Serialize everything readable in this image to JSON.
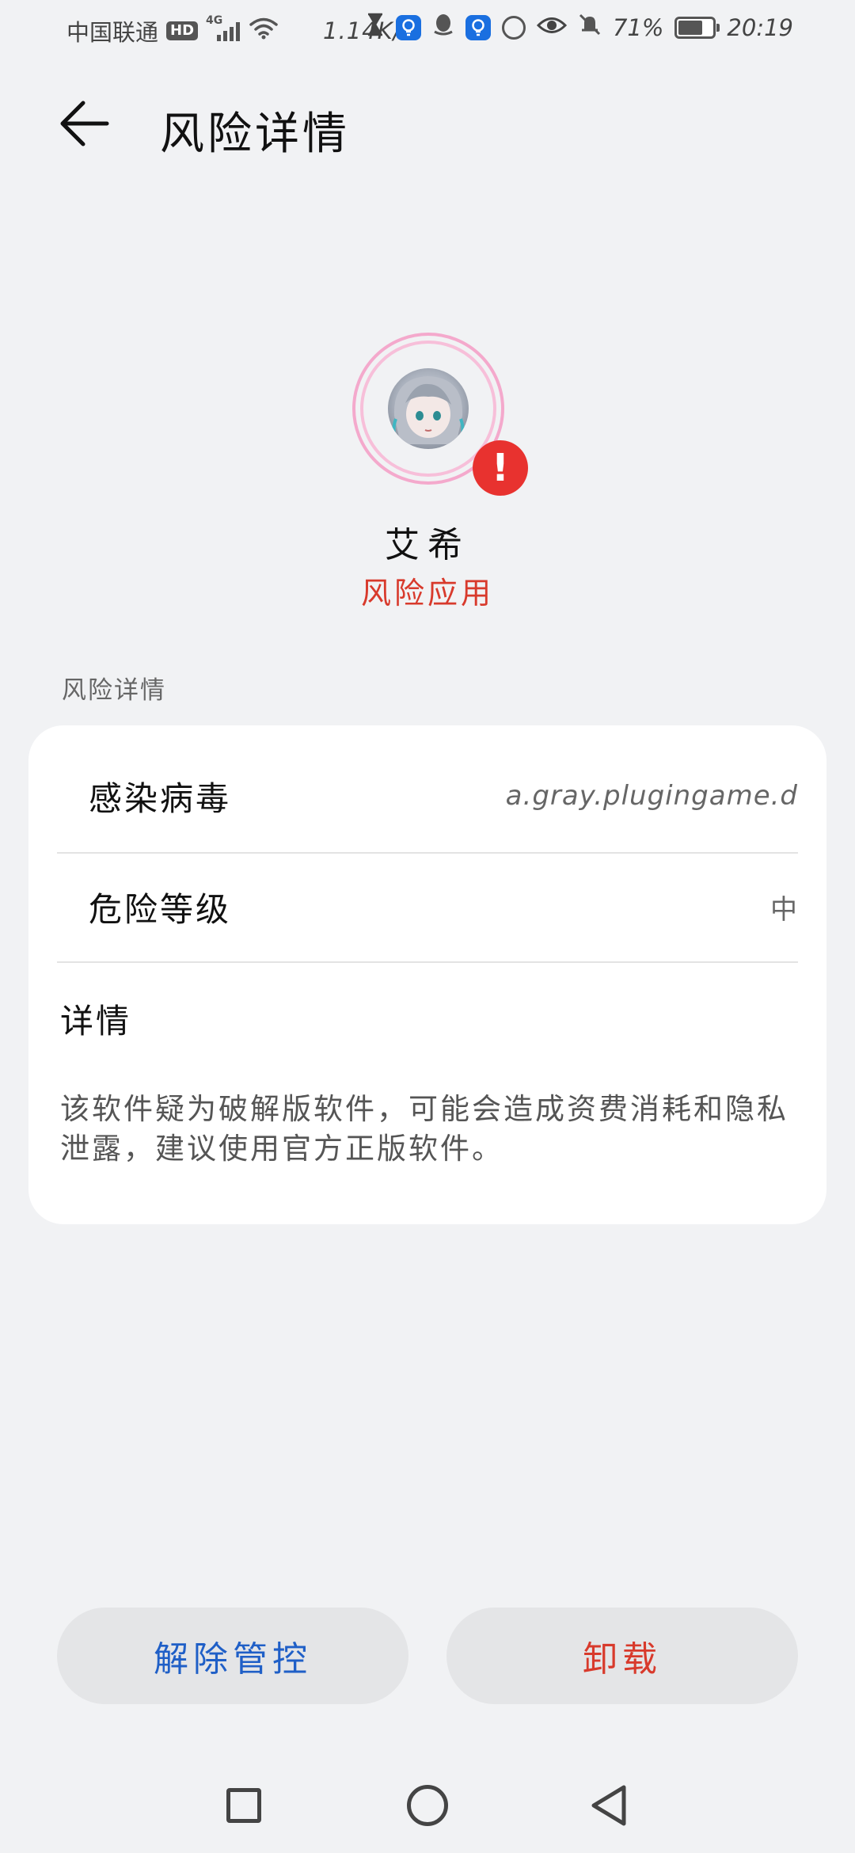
{
  "status_bar": {
    "carrier": "中国联通",
    "hd": "HD",
    "network": "4G",
    "speed": "1.14K/s",
    "battery": "71%",
    "time": "20:19",
    "battery_level": 0.71,
    "icons": [
      "hourglass-icon",
      "bulb-icon",
      "qq-icon",
      "bulb-icon",
      "power-saver-icon",
      "eye-icon",
      "bell-muted-icon",
      "battery-icon"
    ]
  },
  "header": {
    "title": "风险详情",
    "back_icon": "arrow-left-icon"
  },
  "app": {
    "name": "艾希",
    "risk_label": "风险应用",
    "badge": "!"
  },
  "section": {
    "label": "风险详情"
  },
  "details": {
    "virus_label": "感染病毒",
    "virus_value": "a.gray.plugingame.d",
    "level_label": "危险等级",
    "level_value": "中",
    "detail_title": "详情",
    "detail_text": "该软件疑为破解版软件，可能会造成资费消耗和隐私泄露，建议使用官方正版软件。"
  },
  "actions": {
    "release": "解除管控",
    "uninstall": "卸载"
  },
  "nav": {
    "recent": "square-icon",
    "home": "circle-icon",
    "back": "triangle-back-icon"
  },
  "colors": {
    "risk_red": "#d83a2c",
    "link_blue": "#1f5fc7",
    "background": "#f1f2f4"
  }
}
